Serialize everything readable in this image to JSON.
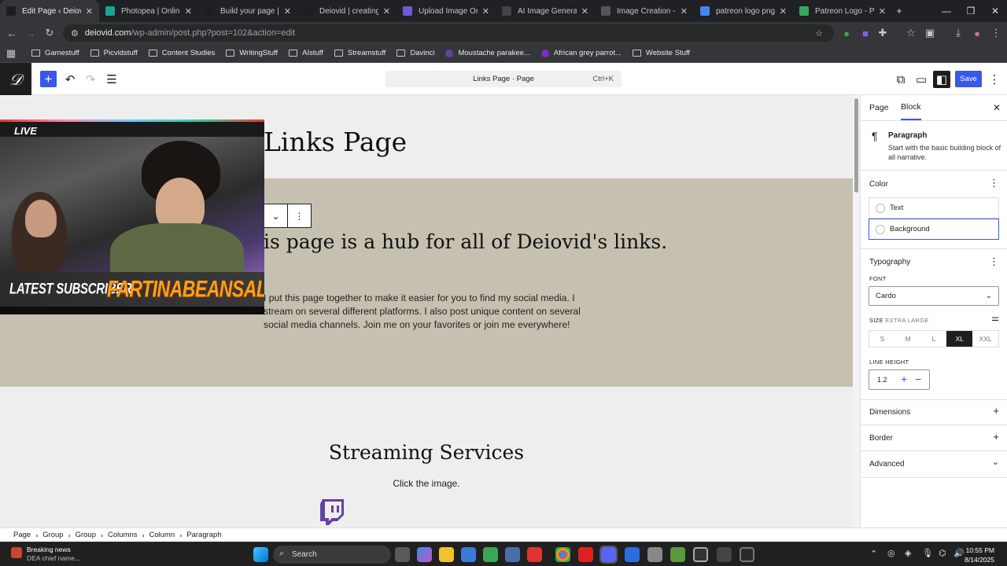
{
  "browser": {
    "tabs": [
      {
        "title": "Edit Page ‹ Deiovid —",
        "color": "#1e1e1e",
        "active": true
      },
      {
        "title": "Photopea | Online Ph",
        "color": "#18a497"
      },
      {
        "title": "Build your page | Patr",
        "color": "#1e1e1e"
      },
      {
        "title": "Deiovid | creating Stre",
        "color": "#1e1e1e"
      },
      {
        "title": "Upload Image Online",
        "color": "#6b5bd6"
      },
      {
        "title": "AI Image Generator -",
        "color": "#444"
      },
      {
        "title": "Image Creation - Leon",
        "color": "#555"
      },
      {
        "title": "patreon logo png - G",
        "color": "#4285f4"
      },
      {
        "title": "Patreon Logo - Patre",
        "color": "#3aa757"
      }
    ],
    "url_host": "deiovid.com",
    "url_path": "/wp-admin/post.php?post=102&action=edit",
    "bookmarks": [
      {
        "label": "Gamestuff",
        "kind": "folder"
      },
      {
        "label": "Picvidstuff",
        "kind": "folder"
      },
      {
        "label": "Content Studies",
        "kind": "folder"
      },
      {
        "label": "WritingStuff",
        "kind": "folder"
      },
      {
        "label": "AIstuff",
        "kind": "folder"
      },
      {
        "label": "Streamstuff",
        "kind": "folder"
      },
      {
        "label": "Davinci",
        "kind": "folder"
      },
      {
        "label": "Moustache parakee...",
        "kind": "site",
        "color": "#6a3fa0"
      },
      {
        "label": "African grey parrot...",
        "kind": "site",
        "color": "#7a2fc0"
      },
      {
        "label": "Website Stuff",
        "kind": "folder"
      }
    ]
  },
  "editor": {
    "command_label": "Links Page · Page",
    "command_shortcut": "Ctrl+K",
    "save_label": "Save"
  },
  "canvas": {
    "page_title": "Links Page",
    "hub_text": "is page is a hub for all of Deiovid's links.",
    "body_text": "I put this page together to make it easier for you to find my social media. I stream on several different platforms. I also post unique content on several social media channels. Join me on your favorites or join me everywhere!",
    "streaming_title": "Streaming Services",
    "click_text": "Click the image.",
    "band_color": "#c6c0b1"
  },
  "overlay": {
    "live_label": "LIVE",
    "subscriber_label": "LATEST SUBSCRIBER",
    "subscriber_name": "FARTINABEANSALCA"
  },
  "sidebar": {
    "tab_page": "Page",
    "tab_block": "Block",
    "block_name": "Paragraph",
    "block_desc": "Start with the basic building block of all narrative.",
    "color_title": "Color",
    "color_text": "Text",
    "color_background": "Background",
    "typography_title": "Typography",
    "font_label": "FONT",
    "font_value": "Cardo",
    "size_label": "SIZE",
    "size_value": "EXTRA LARGE",
    "sizes": [
      "S",
      "M",
      "L",
      "XL",
      "XXL"
    ],
    "size_selected": "XL",
    "line_height_label": "LINE HEIGHT",
    "line_height_value": "1.2",
    "dimensions": "Dimensions",
    "border": "Border",
    "advanced": "Advanced"
  },
  "breadcrumb": [
    "Page",
    "Group",
    "Group",
    "Columns",
    "Column",
    "Paragraph"
  ],
  "taskbar": {
    "news_title": "Breaking news",
    "news_sub": "DEA chief name...",
    "search_label": "Search",
    "time": "10:55 PM",
    "date": "8/14/2025"
  }
}
